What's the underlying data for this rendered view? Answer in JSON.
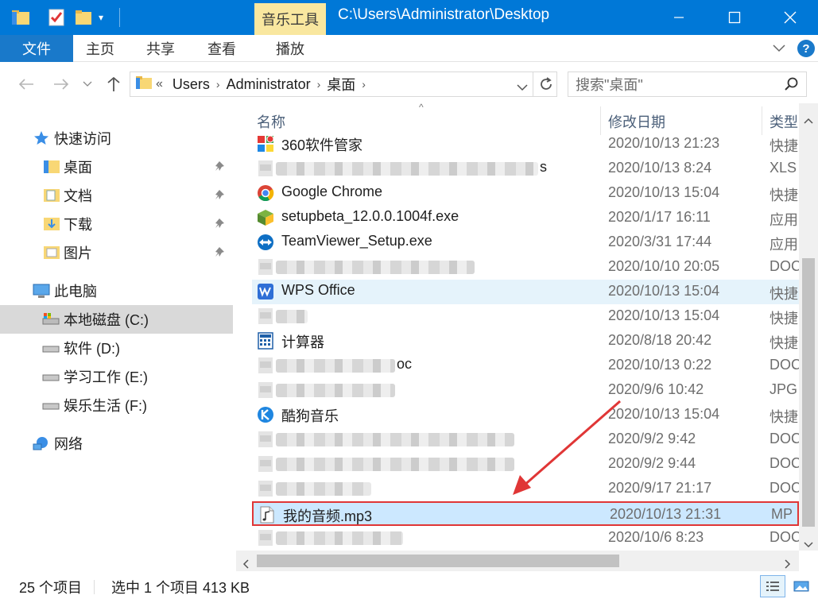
{
  "window": {
    "context_tab": "音乐工具",
    "title": "C:\\Users\\Administrator\\Desktop"
  },
  "ribbon": {
    "tabs": [
      "文件",
      "主页",
      "共享",
      "查看",
      "播放"
    ]
  },
  "address": {
    "crumbs": [
      "Users",
      "Administrator",
      "桌面"
    ],
    "search_placeholder": "搜索\"桌面\""
  },
  "nav": {
    "quick_access": "快速访问",
    "quick_items": [
      "桌面",
      "文档",
      "下载",
      "图片"
    ],
    "this_pc": "此电脑",
    "drives": [
      "本地磁盘 (C:)",
      "软件 (D:)",
      "学习工作 (E:)",
      "娱乐生活 (F:)"
    ],
    "network": "网络"
  },
  "columns": {
    "name": "名称",
    "date": "修改日期",
    "type": "类型"
  },
  "files": [
    {
      "name": "360软件管家",
      "date": "2020/10/13 21:23",
      "type": "快捷",
      "icon": "app-360-icon"
    },
    {
      "name": "s",
      "date": "2020/10/13 8:24",
      "type": "XLS",
      "icon": "blurred",
      "blur": 330
    },
    {
      "name": "Google Chrome",
      "date": "2020/10/13 15:04",
      "type": "快捷",
      "icon": "chrome-icon"
    },
    {
      "name": "setupbeta_12.0.0.1004f.exe",
      "date": "2020/1/17 16:11",
      "type": "应用",
      "icon": "setup-icon"
    },
    {
      "name": "TeamViewer_Setup.exe",
      "date": "2020/3/31 17:44",
      "type": "应用",
      "icon": "teamviewer-icon"
    },
    {
      "name": "",
      "date": "2020/10/10 20:05",
      "type": "DOC",
      "icon": "blurred",
      "blur": 250
    },
    {
      "name": "WPS Office",
      "date": "2020/10/13 15:04",
      "type": "快捷",
      "icon": "wps-icon"
    },
    {
      "name": "",
      "date": "2020/10/13 15:04",
      "type": "快捷",
      "icon": "blurred",
      "blur": 40
    },
    {
      "name": "计算器",
      "date": "2020/8/18 20:42",
      "type": "快捷",
      "icon": "calculator-icon"
    },
    {
      "name": "oc",
      "date": "2020/10/13 0:22",
      "type": "DOC",
      "icon": "blurred",
      "blur": 150
    },
    {
      "name": "",
      "date": "2020/9/6 10:42",
      "type": "JPG",
      "icon": "blurred",
      "blur": 150
    },
    {
      "name": "酷狗音乐",
      "date": "2020/10/13 15:04",
      "type": "快捷",
      "icon": "kugou-icon"
    },
    {
      "name": "",
      "date": "2020/9/2 9:42",
      "type": "DOC",
      "icon": "blurred",
      "blur": 300
    },
    {
      "name": "",
      "date": "2020/9/2 9:44",
      "type": "DOC",
      "icon": "blurred",
      "blur": 300
    },
    {
      "name": "",
      "date": "2020/9/17 21:17",
      "type": "DOC",
      "icon": "blurred",
      "blur": 120
    },
    {
      "name": "我的音频.mp3",
      "date": "2020/10/13 21:31",
      "type": "MP",
      "icon": "audio-file-icon",
      "selected": true
    },
    {
      "name": "",
      "date": "2020/10/6 8:23",
      "type": "DOC",
      "icon": "blurred",
      "blur": 160
    }
  ],
  "status": {
    "count": "25 个项目",
    "selection": "选中 1 个项目  413 KB"
  },
  "colors": {
    "titlebar": "#0078d7",
    "context_tab": "#f9e79f",
    "selection": "#cce8ff",
    "annotation": "#e03636"
  }
}
